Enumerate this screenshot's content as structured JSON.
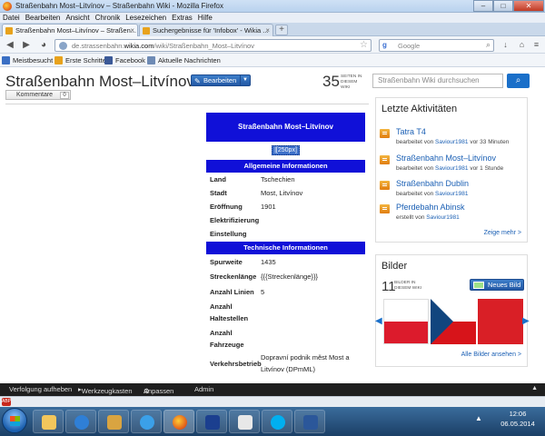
{
  "window": {
    "title": "Straßenbahn Most–Litvínov – Straßenbahn Wiki - Mozilla Firefox",
    "minimize": "–",
    "maximize": "□",
    "close": "✕"
  },
  "menu": [
    "Datei",
    "Bearbeiten",
    "Ansicht",
    "Chronik",
    "Lesezeichen",
    "Extras",
    "Hilfe"
  ],
  "tabs": [
    {
      "label": "Straßenbahn Most–Litvínov – Straßen...",
      "close": "×",
      "active": true
    },
    {
      "label": "Suchergebnisse für 'Infobox' - Wikia ...",
      "close": "×",
      "active": false
    }
  ],
  "newtab": "+",
  "nav": {
    "back": "◀",
    "forward": "▶",
    "url_domain_pre": "de.strassenbahn.",
    "url_domain": "wikia.com",
    "url_path": "/wiki/Straßenbahn_Most–Litvínov",
    "star": "☆",
    "search_engine": "g",
    "search_placeholder": "Google",
    "search_icon": "⌕",
    "home": "⌂",
    "download": "↓"
  },
  "bookmarks": [
    {
      "label": "Meistbesucht",
      "color": "#3a6fc4"
    },
    {
      "label": "Erste Schritte",
      "color": "#e8a21c"
    },
    {
      "label": "Facebook",
      "color": "#3b5998"
    },
    {
      "label": "Aktuelle Nachrichten",
      "color": "#6e8bb5"
    }
  ],
  "wiki": {
    "title": "Straßenbahn Most–Litvínov",
    "edit": "Bearbeiten",
    "edit_dropdown": "▼",
    "comments": "Kommentare",
    "comments_count": "0",
    "page_count": "35",
    "page_count_label": "SEITEN IN DIESEM WIKI",
    "search_placeholder": "Straßenbahn Wiki durchsuchen",
    "search_button": "⌕"
  },
  "infobox": {
    "heading": "Straßenbahn Most–Litvínov",
    "image_placeholder": "|[250px]",
    "section1": "Allgemeine Informationen",
    "rows1": [
      {
        "key": "Land",
        "value": "Tschechien"
      },
      {
        "key": "Stadt",
        "value": "Most, Litvínov"
      },
      {
        "key": "Eröffnung",
        "value": "1901"
      },
      {
        "key": "Elektrifizierung",
        "value": ""
      },
      {
        "key": "Einstellung",
        "value": ""
      }
    ],
    "section2": "Technische Informationen",
    "rows2": [
      {
        "key": "Spurweite",
        "value": "1435"
      },
      {
        "key": "Streckenlänge",
        "value": "{{{Streckenlänge}}}"
      },
      {
        "key": "Anzahl Linien",
        "value": "5"
      },
      {
        "key": "Anzahl Haltestellen",
        "value": ""
      },
      {
        "key": "Anzahl Fahrzeuge",
        "value": ""
      },
      {
        "key": "Verkehrsbetrieb",
        "value": "Dopravní podnik měst Most a Litvínov (DPmML)"
      }
    ]
  },
  "activities": {
    "heading": "Letzte Aktivitäten",
    "items": [
      {
        "title": "Tatra T4",
        "meta_pre": "bearbeitet von ",
        "user": "Saviour1981",
        "meta_post": " vor 33 Minuten"
      },
      {
        "title": "Straßenbahn Most–Litvínov",
        "meta_pre": "bearbeitet von ",
        "user": "Saviour1981",
        "meta_post": " vor 1 Stunde"
      },
      {
        "title": "Straßenbahn Dublin",
        "meta_pre": "bearbeitet von ",
        "user": "Saviour1981",
        "meta_post": ""
      },
      {
        "title": "Pferdebahn Abinsk",
        "meta_pre": "erstellt von ",
        "user": "Saviour1981",
        "meta_post": ""
      }
    ],
    "more": "Zeige mehr >"
  },
  "images": {
    "heading": "Bilder",
    "count": "11",
    "count_label": "BILDER IN DIESEM WIKI",
    "add": "Neues Bild",
    "prev": "◀",
    "next": "▶",
    "all": "Alle Bilder ansehen >"
  },
  "toolbar": {
    "unfollow": "Verfolgung aufheben",
    "tools": "Werkzeugkasten",
    "customize": "Anpassen",
    "admin": "Admin",
    "collapse": "▲"
  },
  "statusbar": {
    "abp": "ABP"
  },
  "taskbar": {
    "tray": "▲",
    "time": "12:06",
    "date": "06.05.2014"
  }
}
